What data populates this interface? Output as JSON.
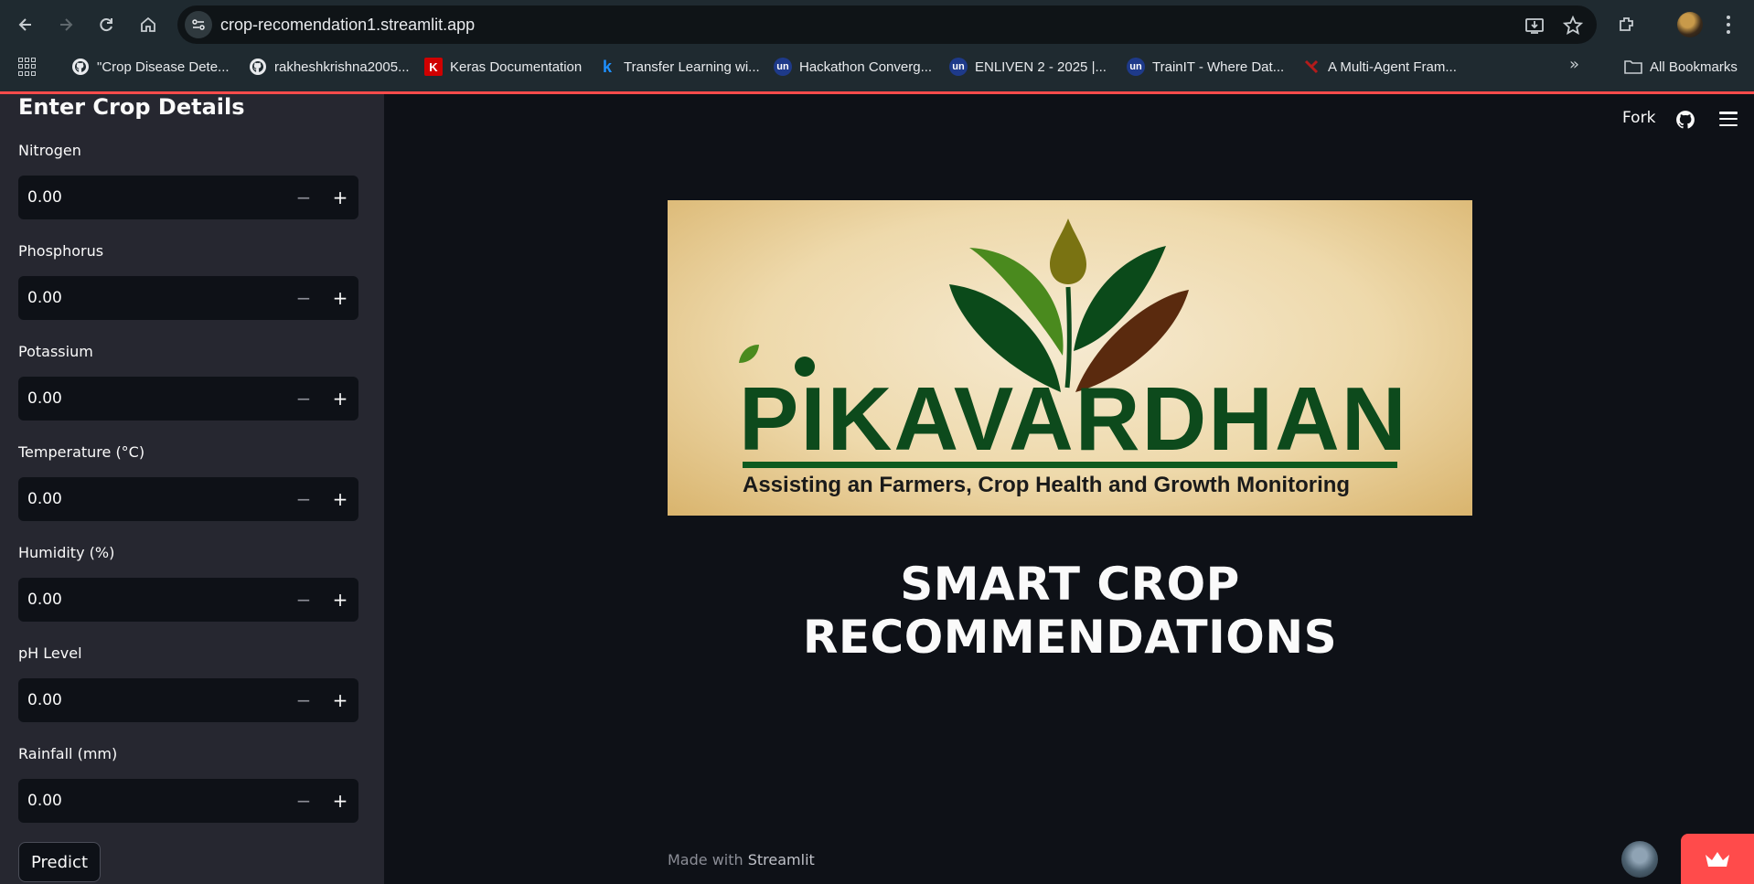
{
  "browser": {
    "url": "crop-recomendation1.streamlit.app",
    "bookmarks": [
      {
        "label": "\"Crop Disease Dete...",
        "icon": "github-icon"
      },
      {
        "label": "rakheshkrishna2005...",
        "icon": "github-icon"
      },
      {
        "label": "Keras Documentation",
        "icon": "keras-icon"
      },
      {
        "label": "Transfer Learning wi...",
        "icon": "kaggle-icon"
      },
      {
        "label": "Hackathon Converg...",
        "icon": "unstop-icon"
      },
      {
        "label": "ENLIVEN 2 - 2025 |...",
        "icon": "unstop-icon"
      },
      {
        "label": "TrainIT - Where Dat...",
        "icon": "unstop-icon"
      },
      {
        "label": "A Multi-Agent Fram...",
        "icon": "arxiv-icon"
      }
    ],
    "all_bookmarks": "All Bookmarks"
  },
  "sidebar": {
    "title": "Enter Crop Details",
    "fields": [
      {
        "label": "Nitrogen",
        "value": "0.00"
      },
      {
        "label": "Phosphorus",
        "value": "0.00"
      },
      {
        "label": "Potassium",
        "value": "0.00"
      },
      {
        "label": "Temperature (°C)",
        "value": "0.00"
      },
      {
        "label": "Humidity (%)",
        "value": "0.00"
      },
      {
        "label": "pH Level",
        "value": "0.00"
      },
      {
        "label": "Rainfall (mm)",
        "value": "0.00"
      }
    ],
    "predict_label": "Predict"
  },
  "header": {
    "fork_label": "Fork"
  },
  "banner": {
    "brand": "PIKAVARDHAN",
    "tagline": "Assisting an Farmers, Crop Health and Growth Monitoring"
  },
  "main": {
    "title": "SMART CROP RECOMMENDATIONS"
  },
  "footer": {
    "prefix": "Made with",
    "brand": "Streamlit"
  },
  "colors": {
    "accent": "#ff4b4b",
    "background": "#0e1117",
    "sidebar": "#262730",
    "brand_green": "#0d4a1c",
    "leaf_brown": "#5a2a0e"
  }
}
